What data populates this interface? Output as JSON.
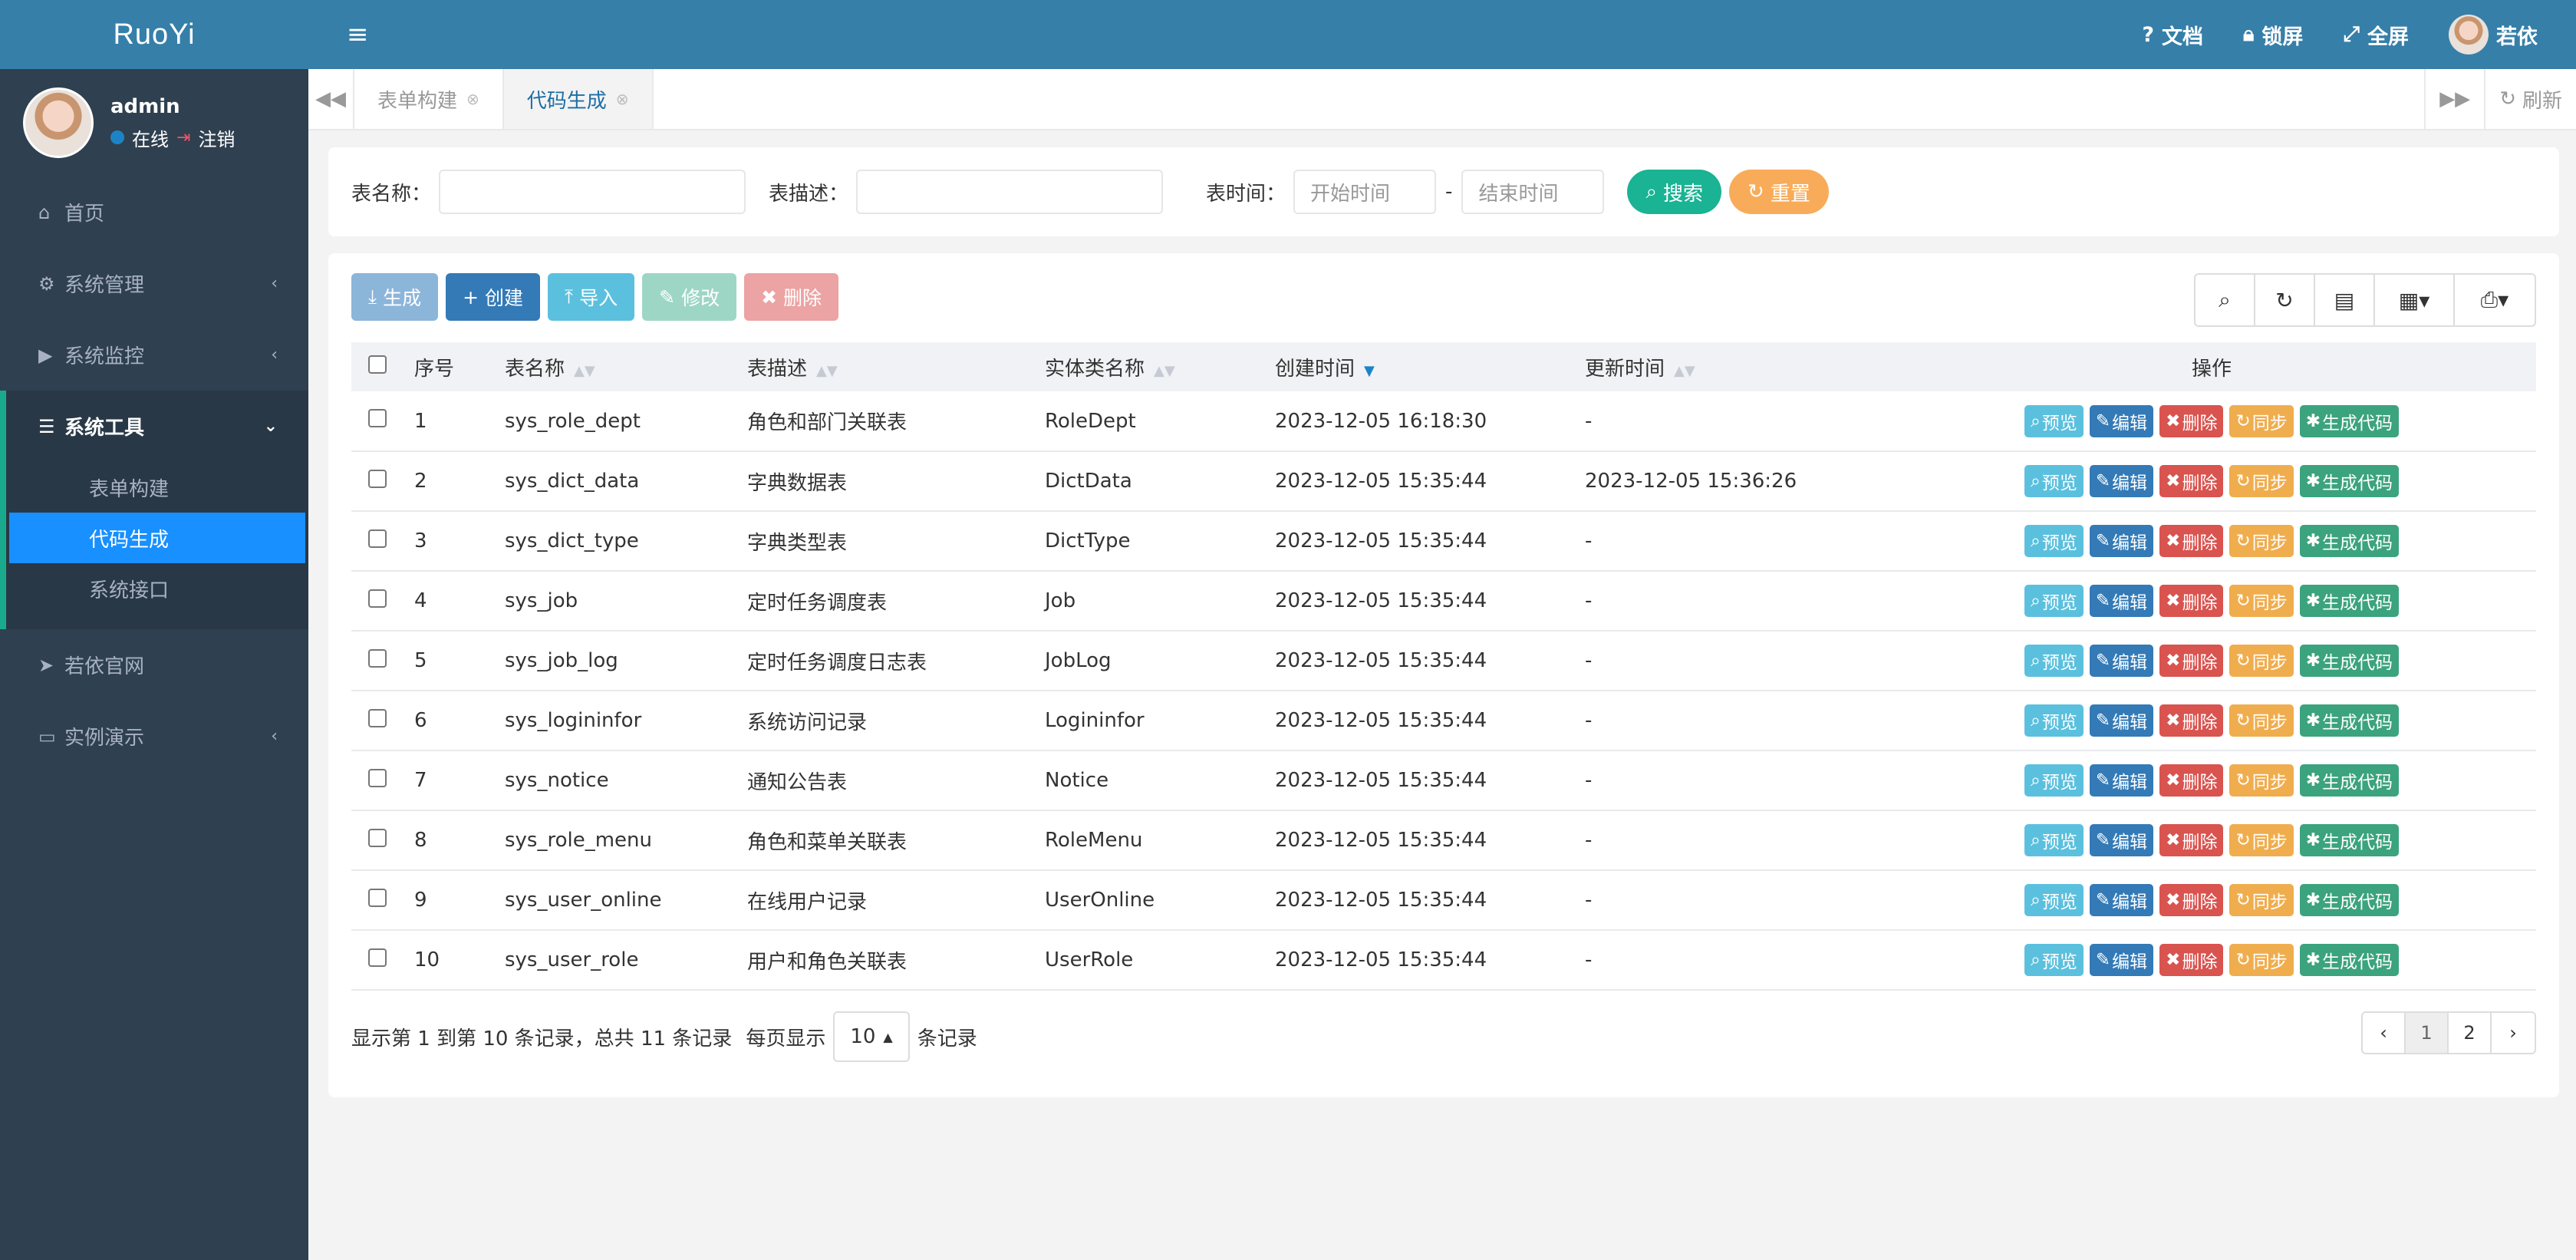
{
  "app": {
    "logo": "RuoYi"
  },
  "user": {
    "name": "admin",
    "status": "在线",
    "logout": "注销"
  },
  "sidebar": {
    "items": [
      {
        "icon": "home-icon",
        "glyph": "⌂",
        "label": "首页"
      },
      {
        "icon": "gear-icon",
        "glyph": "⚙",
        "label": "系统管理",
        "chevron": "‹"
      },
      {
        "icon": "camera-icon",
        "glyph": "▶",
        "label": "系统监控",
        "chevron": "‹"
      },
      {
        "icon": "bars-icon",
        "glyph": "☰",
        "label": "系统工具",
        "chevron": "⌄",
        "open": true,
        "children": [
          {
            "label": "表单构建"
          },
          {
            "label": "代码生成",
            "active": true
          },
          {
            "label": "系统接口"
          }
        ]
      },
      {
        "icon": "send-icon",
        "glyph": "➤",
        "label": "若依官网"
      },
      {
        "icon": "desktop-icon",
        "glyph": "▭",
        "label": "实例演示",
        "chevron": "‹"
      }
    ]
  },
  "header": {
    "menu_glyph": "≡",
    "doc": "文档",
    "lock": "锁屏",
    "fullscreen": "全屏",
    "user": "若依"
  },
  "tabs": [
    {
      "label": "表单构建"
    },
    {
      "label": "代码生成",
      "active": true
    }
  ],
  "tabs_right": {
    "refresh": "刷新"
  },
  "search": {
    "table_name_label": "表名称：",
    "table_desc_label": "表描述：",
    "time_label": "表时间：",
    "start_placeholder": "开始时间",
    "end_placeholder": "结束时间",
    "dash": "-",
    "search_btn": "搜索",
    "reset_btn": "重置"
  },
  "toolbar": {
    "generate": "生成",
    "create": "创建",
    "import": "导入",
    "edit": "修改",
    "delete": "删除"
  },
  "table": {
    "headers": {
      "index": "序号",
      "table_name": "表名称",
      "table_desc": "表描述",
      "class_name": "实体类名称",
      "create_time": "创建时间",
      "update_time": "更新时间",
      "ops": "操作"
    },
    "ops": {
      "preview": "预览",
      "edit": "编辑",
      "delete": "删除",
      "sync": "同步",
      "gencode": "生成代码"
    },
    "rows": [
      {
        "index": "1",
        "table_name": "sys_role_dept",
        "table_desc": "角色和部门关联表",
        "class_name": "RoleDept",
        "create_time": "2023-12-05 16:18:30",
        "update_time": "-"
      },
      {
        "index": "2",
        "table_name": "sys_dict_data",
        "table_desc": "字典数据表",
        "class_name": "DictData",
        "create_time": "2023-12-05 15:35:44",
        "update_time": "2023-12-05 15:36:26"
      },
      {
        "index": "3",
        "table_name": "sys_dict_type",
        "table_desc": "字典类型表",
        "class_name": "DictType",
        "create_time": "2023-12-05 15:35:44",
        "update_time": "-"
      },
      {
        "index": "4",
        "table_name": "sys_job",
        "table_desc": "定时任务调度表",
        "class_name": "Job",
        "create_time": "2023-12-05 15:35:44",
        "update_time": "-"
      },
      {
        "index": "5",
        "table_name": "sys_job_log",
        "table_desc": "定时任务调度日志表",
        "class_name": "JobLog",
        "create_time": "2023-12-05 15:35:44",
        "update_time": "-"
      },
      {
        "index": "6",
        "table_name": "sys_logininfor",
        "table_desc": "系统访问记录",
        "class_name": "Logininfor",
        "create_time": "2023-12-05 15:35:44",
        "update_time": "-"
      },
      {
        "index": "7",
        "table_name": "sys_notice",
        "table_desc": "通知公告表",
        "class_name": "Notice",
        "create_time": "2023-12-05 15:35:44",
        "update_time": "-"
      },
      {
        "index": "8",
        "table_name": "sys_role_menu",
        "table_desc": "角色和菜单关联表",
        "class_name": "RoleMenu",
        "create_time": "2023-12-05 15:35:44",
        "update_time": "-"
      },
      {
        "index": "9",
        "table_name": "sys_user_online",
        "table_desc": "在线用户记录",
        "class_name": "UserOnline",
        "create_time": "2023-12-05 15:35:44",
        "update_time": "-"
      },
      {
        "index": "10",
        "table_name": "sys_user_role",
        "table_desc": "用户和角色关联表",
        "class_name": "UserRole",
        "create_time": "2023-12-05 15:35:44",
        "update_time": "-"
      }
    ]
  },
  "pager": {
    "info": "显示第 1 到第 10 条记录，总共 11 条记录",
    "per_page_label": "每页显示",
    "page_size": "10",
    "records_label": "条记录",
    "prev": "‹",
    "next": "›",
    "pages": [
      "1",
      "2"
    ]
  },
  "colors": {
    "header": "#367fa9",
    "sidebar": "#2f4050",
    "active_menu": "#1890ff",
    "search_btn": "#1ab394",
    "reset_btn": "#f8ac59"
  }
}
